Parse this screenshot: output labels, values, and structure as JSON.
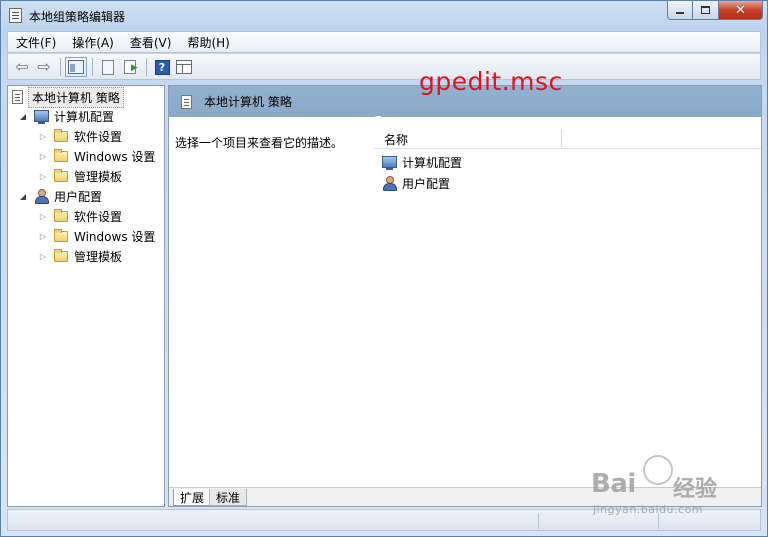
{
  "window": {
    "title": "本地组策略编辑器",
    "min_glyph": "",
    "close_glyph": "✕"
  },
  "menu": {
    "items": [
      "文件(F)",
      "操作(A)",
      "查看(V)",
      "帮助(H)"
    ]
  },
  "toolbar": {
    "back_glyph": "⇦",
    "forward_glyph": "⇨",
    "help_glyph": "?",
    "icons": [
      "back-arrow-icon",
      "forward-arrow-icon",
      "show-hide-tree-icon",
      "properties-icon",
      "export-list-icon",
      "help-icon",
      "extended-view-icon"
    ]
  },
  "overlay": {
    "command": "gpedit.msc"
  },
  "tree": {
    "root": "本地计算机 策略",
    "computer_config": {
      "label": "计算机配置",
      "children": [
        "软件设置",
        "Windows 设置",
        "管理模板"
      ]
    },
    "user_config": {
      "label": "用户配置",
      "children": [
        "软件设置",
        "Windows 设置",
        "管理模板"
      ]
    },
    "expanded_glyph": "◢",
    "collapsed_glyph": "▷"
  },
  "right_pane": {
    "header": "本地计算机 策略",
    "description": "选择一个项目来查看它的描述。",
    "column_name": "名称",
    "rows": [
      "计算机配置",
      "用户配置"
    ],
    "tabs": [
      "扩展",
      "标准"
    ]
  },
  "watermark": {
    "brand": "Bai",
    "brand_suffix": "经验",
    "url": "jingyan.baidu.com"
  },
  "colors": {
    "overlay_text": "#e0141e",
    "header_band": "#8aa9c8"
  }
}
